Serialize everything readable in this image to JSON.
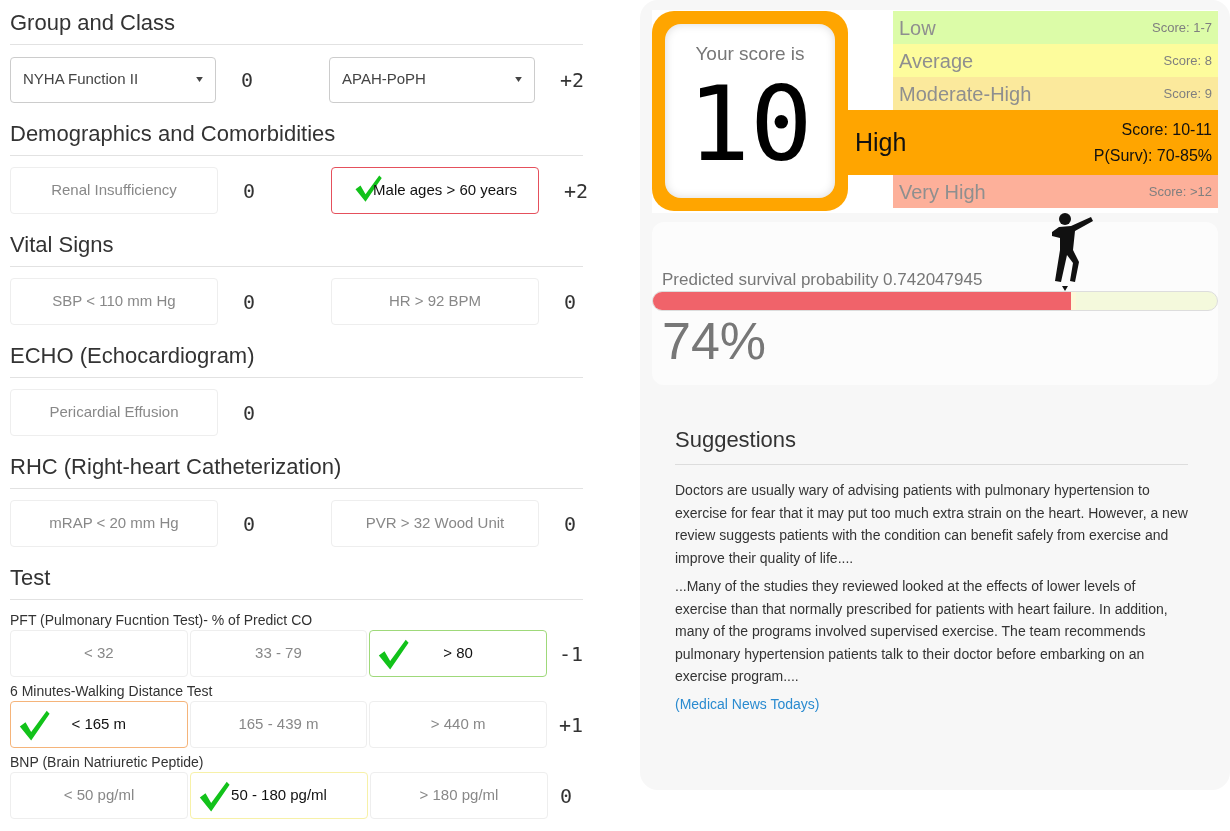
{
  "sections": [
    {
      "title": "Group and Class",
      "fields": [
        {
          "kind": "select",
          "value": "NYHA Function II",
          "points": "0"
        },
        {
          "kind": "select",
          "value": "APAH-PoPH",
          "points": "+2"
        }
      ]
    },
    {
      "title": "Demographics and Comorbidities",
      "fields": [
        {
          "kind": "toggle",
          "label": "Renal Insufficiency",
          "selected": false,
          "points": "0"
        },
        {
          "kind": "toggle",
          "label": "Male ages > 60 years",
          "selected": true,
          "color": "#e5505c",
          "points": "+2"
        }
      ]
    },
    {
      "title": "Vital Signs",
      "fields": [
        {
          "kind": "toggle",
          "label": "SBP < 110 mm Hg",
          "selected": false,
          "points": "0"
        },
        {
          "kind": "toggle",
          "label": "HR > 92 BPM",
          "selected": false,
          "points": "0"
        }
      ]
    },
    {
      "title": "ECHO (Echocardiogram)",
      "fields": [
        {
          "kind": "toggle",
          "label": "Pericardial Effusion",
          "selected": false,
          "points": "0"
        }
      ]
    },
    {
      "title": "RHC (Right-heart Catheterization)",
      "fields": [
        {
          "kind": "toggle",
          "label": "mRAP < 20 mm Hg",
          "selected": false,
          "points": "0"
        },
        {
          "kind": "toggle",
          "label": "PVR > 32 Wood Unit",
          "selected": false,
          "points": "0"
        }
      ]
    },
    {
      "title": "Test",
      "tests": [
        {
          "label": "PFT (Pulmonary Fucntion Test)- % of Predict CO",
          "points": "-1",
          "options": [
            {
              "label": "< 32",
              "selected": false
            },
            {
              "label": "33 - 79",
              "selected": false
            },
            {
              "label": "> 80",
              "selected": true,
              "color": "#9fd97a"
            }
          ]
        },
        {
          "label": "6 Minutes-Walking Distance Test",
          "points": "+1",
          "options": [
            {
              "label": "< 165 m",
              "selected": true,
              "color": "#f5b47a"
            },
            {
              "label": "165 - 439 m",
              "selected": false
            },
            {
              "label": "> 440 m",
              "selected": false
            }
          ]
        },
        {
          "label": "BNP (Brain Natriuretic Peptide)",
          "points": "0",
          "options": [
            {
              "label": "< 50 pg/ml",
              "selected": false
            },
            {
              "label": "50 - 180 pg/ml",
              "selected": true,
              "color": "#f7f1a8"
            },
            {
              "label": "> 180 pg/ml",
              "selected": false
            }
          ]
        }
      ]
    }
  ],
  "score": {
    "caption": "Your score is",
    "value": "10"
  },
  "risk_levels": [
    {
      "name": "Low",
      "score": "Score: 1-7",
      "selected": false,
      "color": "#dcfca8"
    },
    {
      "name": "Average",
      "score": "Score: 8",
      "selected": false,
      "color": "#fdfc9c"
    },
    {
      "name": "Moderate-High",
      "score": "Score: 9",
      "selected": false,
      "color": "#fbe99c"
    },
    {
      "name": "High",
      "score": "Score: 10-11",
      "survival": "P(Surv): 70-85%",
      "selected": true,
      "color": "#ffa500"
    },
    {
      "name": "Very High",
      "score": "Score: >12",
      "selected": false,
      "color": "#fdb09a"
    }
  ],
  "survival": {
    "label": "Predicted survival probability 0.742047945",
    "level": 0.742,
    "percent": "74%"
  },
  "suggestions": {
    "title": "Suggestions",
    "paragraphs": [
      "Doctors are usually wary of advising patients with pulmonary hypertension to exercise for fear that it may put too much extra strain on the heart. However, a new review suggests patients with the condition can benefit safely from exercise and improve their quality of life....",
      "...Many of the studies they reviewed looked at the effects of lower levels of exercise than that normally prescribed for patients with heart failure. In addition, many of the programs involved supervised exercise. The team recommends pulmonary hypertension patients talk to their doctor before embarking on an exercise program...."
    ],
    "source": "(Medical News Todays)"
  }
}
